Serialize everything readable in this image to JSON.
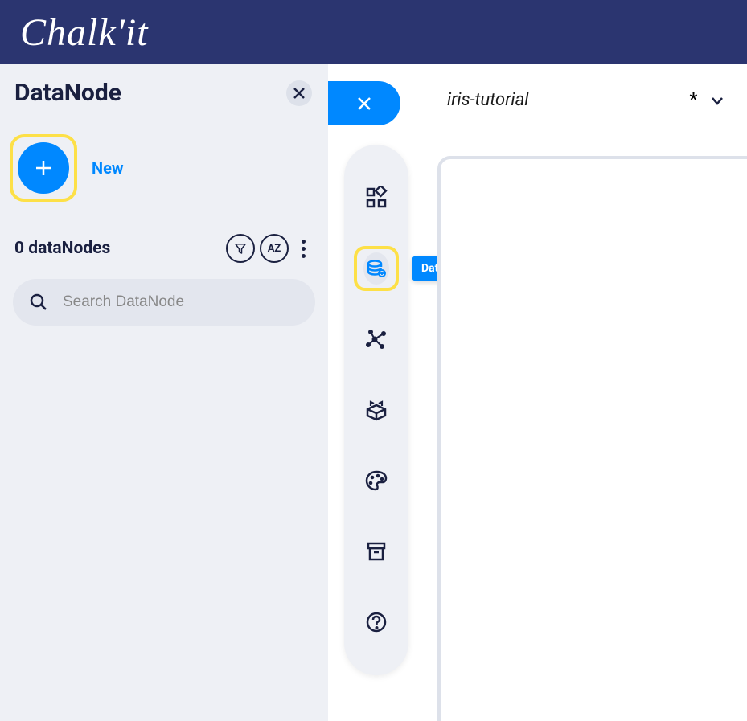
{
  "brand": {
    "name": "Chalk'it"
  },
  "panel": {
    "title": "DataNode",
    "new_label": "New",
    "count_label": "0 dataNodes",
    "search_placeholder": "Search DataNode"
  },
  "project": {
    "title": "iris-tutorial",
    "modified_marker": "*"
  },
  "toolbar": {
    "tooltip_datanodes": "DataNodes"
  }
}
